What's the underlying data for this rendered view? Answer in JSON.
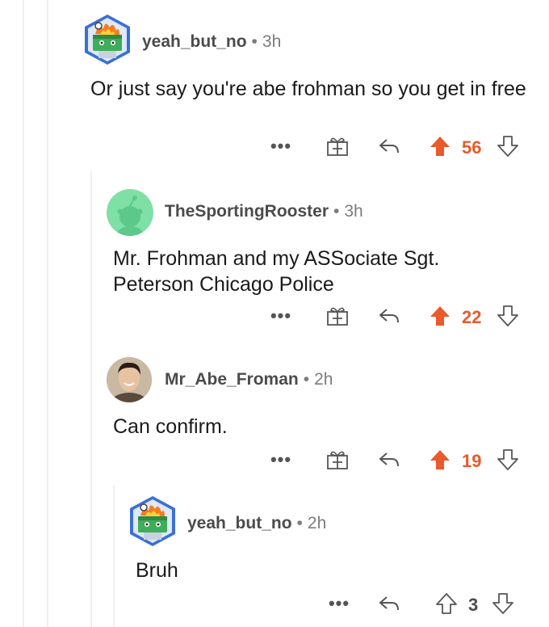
{
  "colors": {
    "upvote": "#ea5a2b",
    "muted": "#7c7c7c",
    "thread": "#edeff1"
  },
  "comments": [
    {
      "username": "yeah_but_no",
      "separator": "•",
      "time": "3h",
      "body": "Or just say you're abe frohman so you get in free",
      "more_label": "•••",
      "score": "56",
      "upvoted": true,
      "has_award": true
    },
    {
      "username": "TheSportingRooster",
      "separator": "•",
      "time": "3h",
      "body": "Mr. Frohman and my ASSociate Sgt. Peterson Chicago Police",
      "more_label": "•••",
      "score": "22",
      "upvoted": true,
      "has_award": true
    },
    {
      "username": "Mr_Abe_Froman",
      "separator": "•",
      "time": "2h",
      "body": "Can confirm.",
      "more_label": "•••",
      "score": "19",
      "upvoted": true,
      "has_award": true
    },
    {
      "username": "yeah_but_no",
      "separator": "•",
      "time": "2h",
      "body": "Bruh",
      "more_label": "•••",
      "score": "3",
      "upvoted": false,
      "has_award": false
    }
  ]
}
